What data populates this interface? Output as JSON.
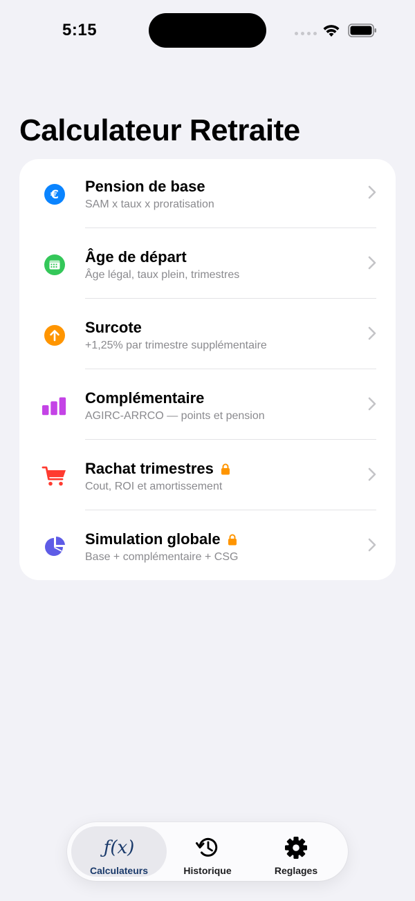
{
  "status_bar": {
    "time": "5:15"
  },
  "page": {
    "title": "Calculateur Retraite"
  },
  "calculators": [
    {
      "title": "Pension de base",
      "subtitle": "SAM x taux x proratisation",
      "icon": "euro-icon",
      "color": "#0a84ff",
      "locked": false
    },
    {
      "title": "Âge de départ",
      "subtitle": "Âge légal, taux plein, trimestres",
      "icon": "calendar-icon",
      "color": "#34c759",
      "locked": false
    },
    {
      "title": "Surcote",
      "subtitle": "+1,25% par trimestre supplémentaire",
      "icon": "arrow-up-icon",
      "color": "#ff9500",
      "locked": false
    },
    {
      "title": "Complémentaire",
      "subtitle": "AGIRC-ARRCO — points et pension",
      "icon": "bar-chart-icon",
      "color": "#c443e6",
      "locked": false
    },
    {
      "title": "Rachat trimestres",
      "subtitle": "Cout, ROI et amortissement",
      "icon": "cart-icon",
      "color": "#ff3b30",
      "locked": true
    },
    {
      "title": "Simulation globale",
      "subtitle": "Base + complémentaire + CSG",
      "icon": "pie-chart-icon",
      "color": "#5e5ce6",
      "locked": true
    }
  ],
  "tabbar": {
    "tabs": [
      {
        "label": "Calculateurs",
        "icon": "function-icon",
        "active": true
      },
      {
        "label": "Historique",
        "icon": "history-icon",
        "active": false
      },
      {
        "label": "Reglages",
        "icon": "gear-icon",
        "active": false
      }
    ],
    "fx_glyph": "ƒ(x)"
  },
  "colors": {
    "accent": "#1a3a6b",
    "lock": "#ff9500",
    "background": "#f2f2f7"
  }
}
